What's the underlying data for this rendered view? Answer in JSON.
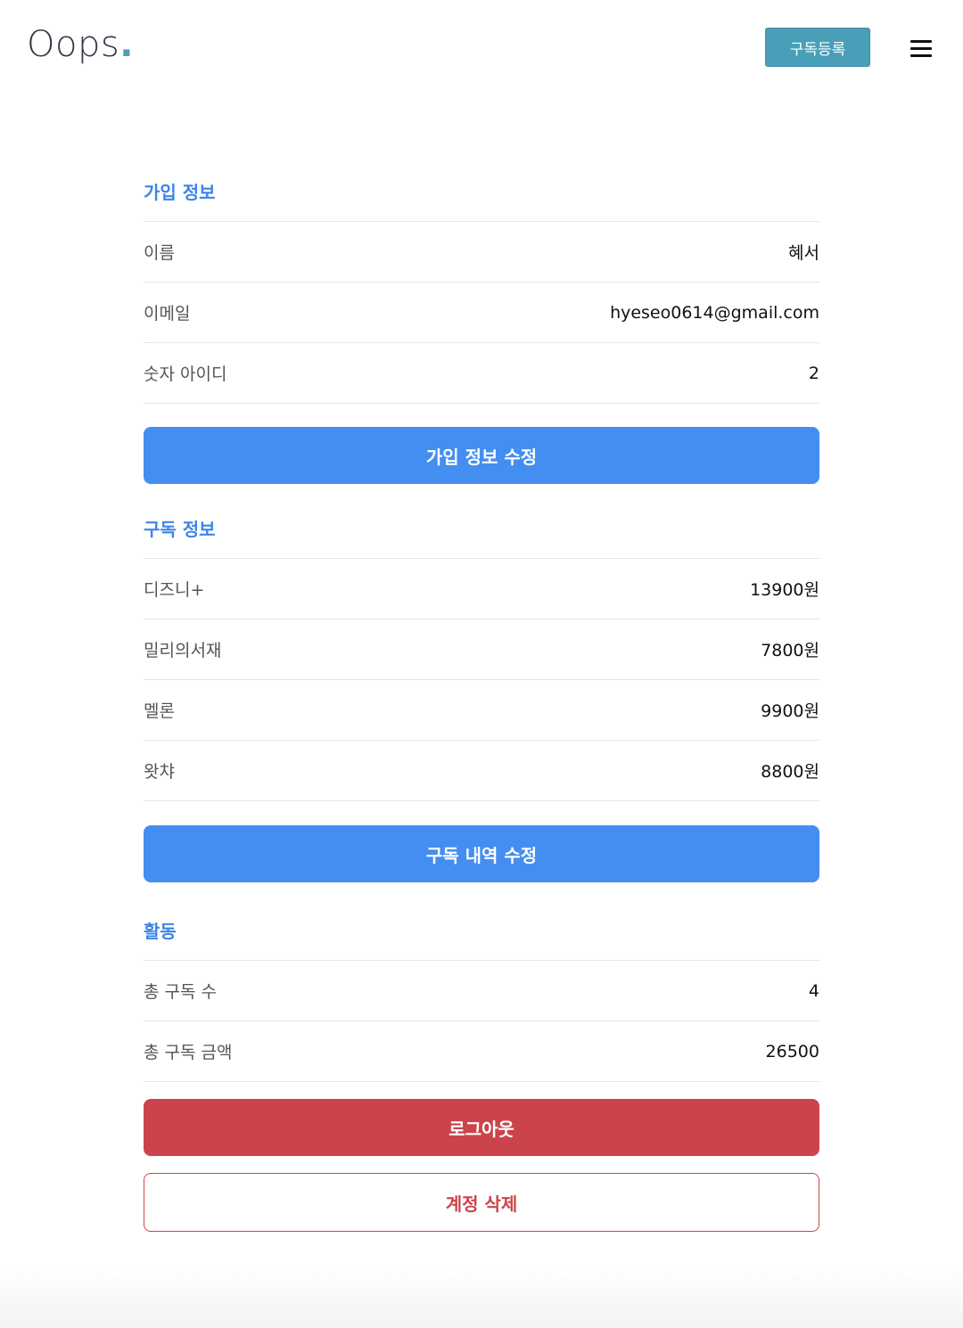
{
  "header": {
    "logo_text": "Oops",
    "logo_dot": ".",
    "subscribe_label": "구독등록",
    "menu_icon": "hamburger-menu-icon"
  },
  "signup_info": {
    "title": "가입 정보",
    "rows": [
      {
        "label": "이름",
        "value": "혜서"
      },
      {
        "label": "이메일",
        "value": "hyeseo0614@gmail.com"
      },
      {
        "label": "숫자 아이디",
        "value": "2"
      }
    ],
    "edit_label": "가입 정보 수정"
  },
  "subscription_info": {
    "title": "구독 정보",
    "rows": [
      {
        "label": "디즈니+",
        "value": "13900원"
      },
      {
        "label": "밀리의서재",
        "value": "7800원"
      },
      {
        "label": "멜론",
        "value": "9900원"
      },
      {
        "label": "왓챠",
        "value": "8800원"
      }
    ],
    "edit_label": "구독 내역 수정"
  },
  "activity": {
    "title": "활동",
    "rows": [
      {
        "label": "총 구독 수",
        "value": "4"
      },
      {
        "label": "총 구독 금액",
        "value": "26500"
      }
    ]
  },
  "actions": {
    "logout_label": "로그아웃",
    "delete_label": "계정 삭제"
  },
  "colors": {
    "accent_teal": "#4a9fb8",
    "primary_blue": "#448ef2",
    "section_title_blue": "#3d86e6",
    "danger_red": "#cc444b"
  }
}
